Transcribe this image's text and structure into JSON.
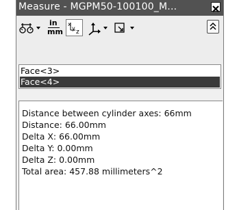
{
  "window": {
    "title": "Measure - MGPM50-100100_M...",
    "close_glyph": "✕"
  },
  "toolbar": {
    "units_top": "in",
    "units_bottom": "mm",
    "icons": [
      "arc-circle-options-icon",
      "units-precision-icon",
      "xyz-projection-icon",
      "coordinate-system-icon",
      "projection-plane-icon",
      "expand-collapse-icon"
    ]
  },
  "selections": [
    {
      "label": "Face<3>",
      "selected": false
    },
    {
      "label": "Face<4>",
      "selected": true
    }
  ],
  "results": [
    "Distance between cylinder axes:  66mm",
    "Distance: 66.00mm",
    "Delta X: 66.00mm",
    "Delta Y: 0.00mm",
    "Delta Z: 0.00mm",
    "Total area: 457.88 millimeters^2"
  ],
  "colors": {
    "titlebar": "#525252",
    "selection_highlight": "#3a3a3a"
  }
}
